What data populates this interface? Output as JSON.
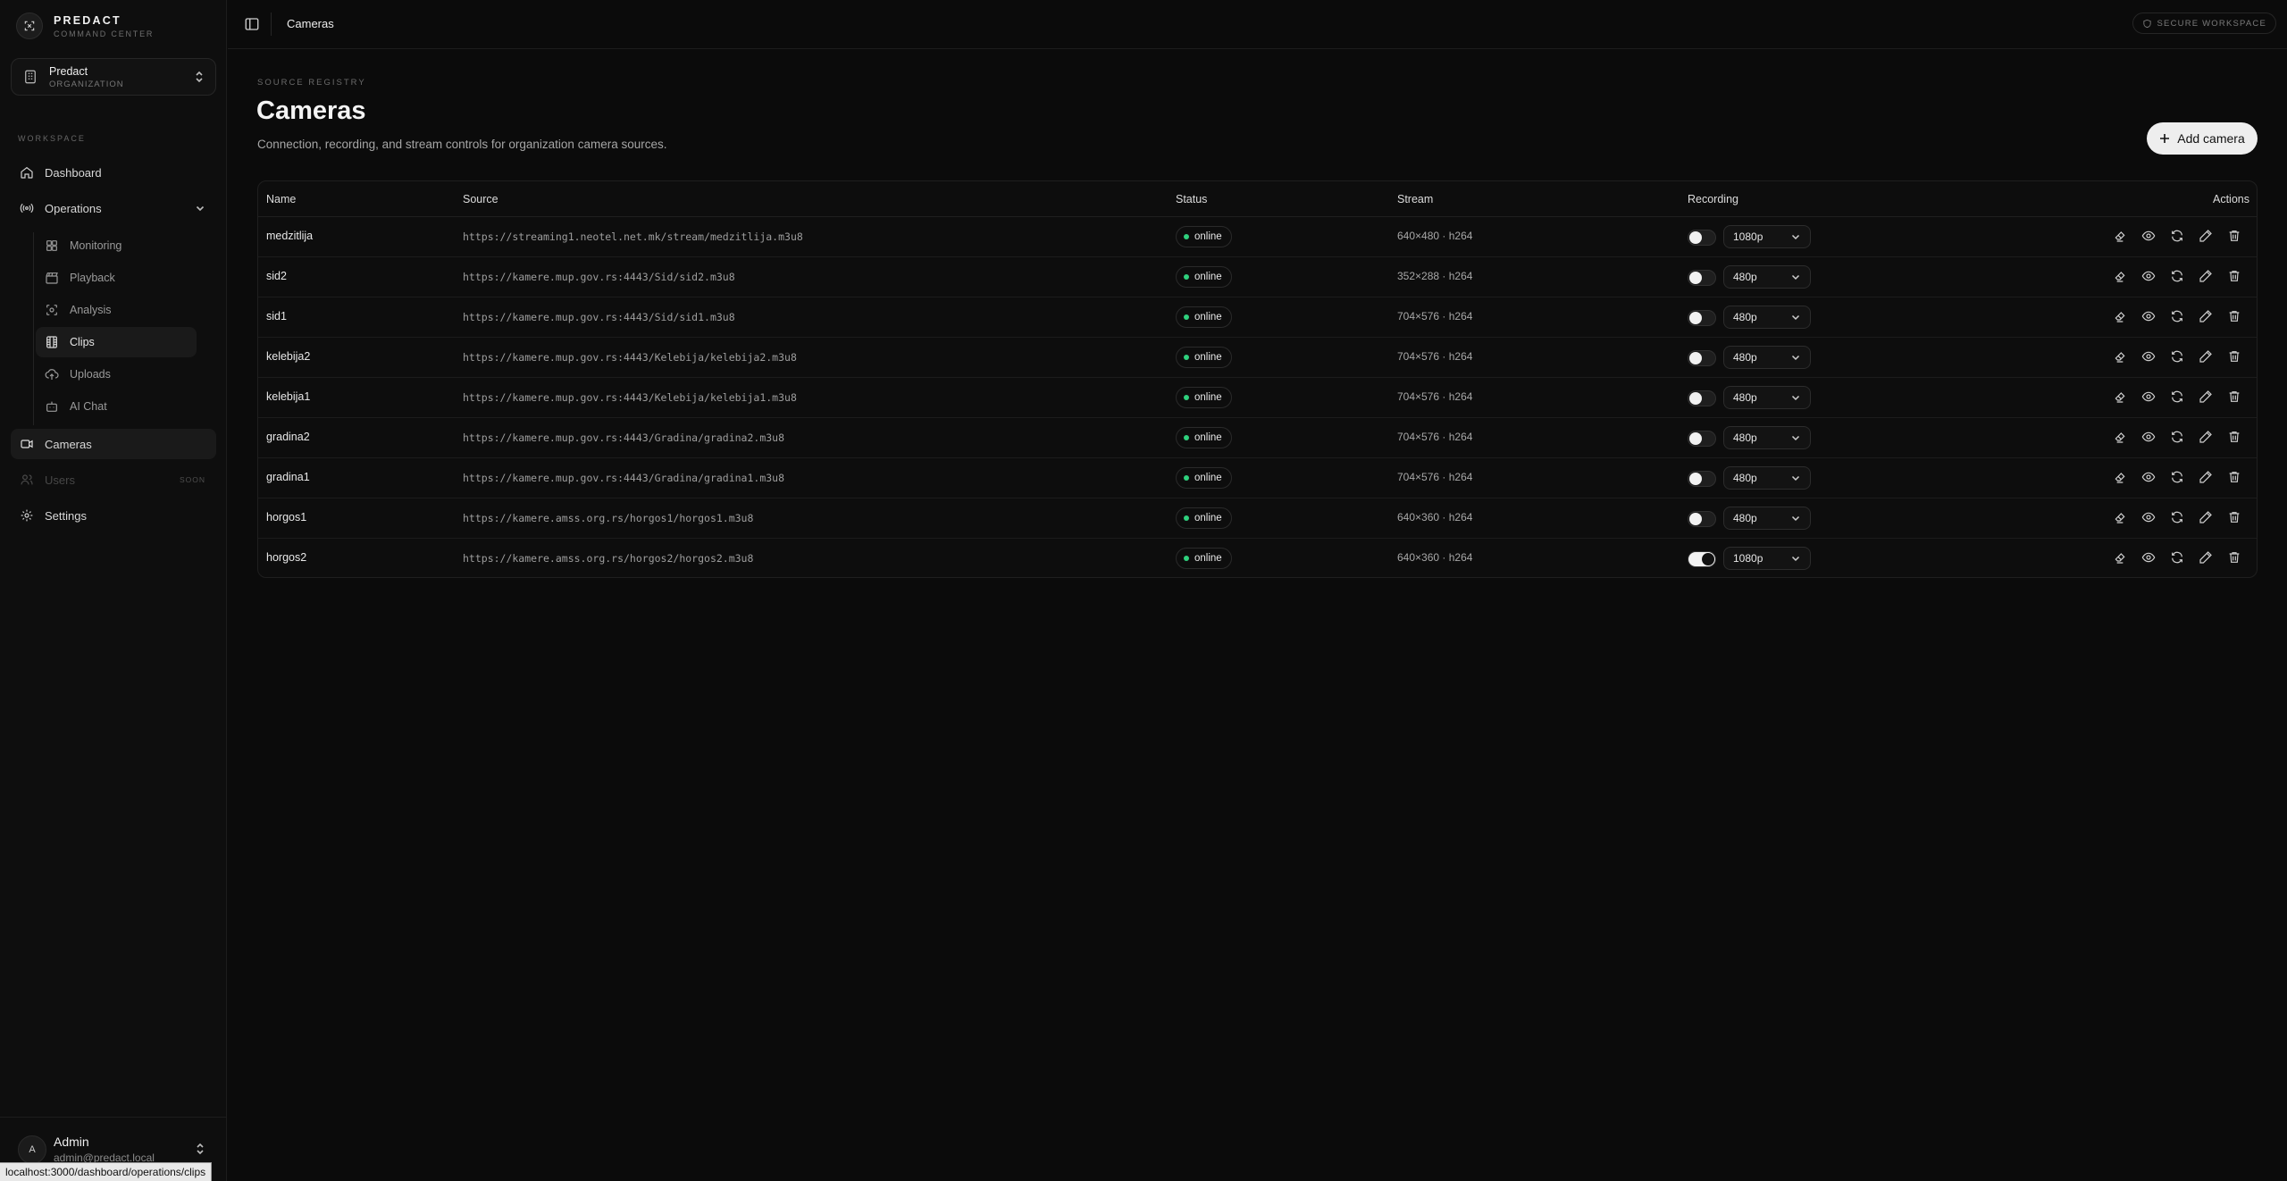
{
  "brand": {
    "name": "PREDACT",
    "subtitle": "COMMAND CENTER"
  },
  "org": {
    "name": "Predact",
    "type": "ORGANIZATION"
  },
  "sidebar": {
    "section_label": "WORKSPACE",
    "items": [
      {
        "label": "Dashboard",
        "icon": "home-icon"
      },
      {
        "label": "Operations",
        "icon": "radio-icon"
      },
      {
        "label": "Monitoring",
        "icon": "grid-icon"
      },
      {
        "label": "Playback",
        "icon": "clapperboard-icon"
      },
      {
        "label": "Analysis",
        "icon": "scan-icon"
      },
      {
        "label": "Clips",
        "icon": "film-icon"
      },
      {
        "label": "Uploads",
        "icon": "cloud-upload-icon"
      },
      {
        "label": "AI Chat",
        "icon": "bot-icon"
      },
      {
        "label": "Cameras",
        "icon": "video-icon"
      },
      {
        "label": "Users",
        "icon": "users-icon",
        "badge": "SOON"
      },
      {
        "label": "Settings",
        "icon": "gear-icon"
      }
    ]
  },
  "user": {
    "initial": "A",
    "name": "Admin",
    "email": "admin@predact.local"
  },
  "topbar": {
    "breadcrumb": "Cameras",
    "badge": "SECURE WORKSPACE"
  },
  "header": {
    "eyebrow": "SOURCE REGISTRY",
    "title": "Cameras",
    "description": "Connection, recording, and stream controls for organization camera sources.",
    "add_button": "Add camera"
  },
  "table": {
    "columns": [
      "Name",
      "Source",
      "Status",
      "Stream",
      "Recording",
      "Actions"
    ],
    "rows": [
      {
        "name": "medzitlija",
        "source": "https://streaming1.neotel.net.mk/stream/medzitlija.m3u8",
        "status": "online",
        "stream": "640×480 · h264",
        "recording": false,
        "resolution": "1080p"
      },
      {
        "name": "sid2",
        "source": "https://kamere.mup.gov.rs:4443/Sid/sid2.m3u8",
        "status": "online",
        "stream": "352×288 · h264",
        "recording": false,
        "resolution": "480p"
      },
      {
        "name": "sid1",
        "source": "https://kamere.mup.gov.rs:4443/Sid/sid1.m3u8",
        "status": "online",
        "stream": "704×576 · h264",
        "recording": false,
        "resolution": "480p"
      },
      {
        "name": "kelebija2",
        "source": "https://kamere.mup.gov.rs:4443/Kelebija/kelebija2.m3u8",
        "status": "online",
        "stream": "704×576 · h264",
        "recording": false,
        "resolution": "480p"
      },
      {
        "name": "kelebija1",
        "source": "https://kamere.mup.gov.rs:4443/Kelebija/kelebija1.m3u8",
        "status": "online",
        "stream": "704×576 · h264",
        "recording": false,
        "resolution": "480p"
      },
      {
        "name": "gradina2",
        "source": "https://kamere.mup.gov.rs:4443/Gradina/gradina2.m3u8",
        "status": "online",
        "stream": "704×576 · h264",
        "recording": false,
        "resolution": "480p"
      },
      {
        "name": "gradina1",
        "source": "https://kamere.mup.gov.rs:4443/Gradina/gradina1.m3u8",
        "status": "online",
        "stream": "704×576 · h264",
        "recording": false,
        "resolution": "480p"
      },
      {
        "name": "horgos1",
        "source": "https://kamere.amss.org.rs/horgos1/horgos1.m3u8",
        "status": "online",
        "stream": "640×360 · h264",
        "recording": false,
        "resolution": "480p"
      },
      {
        "name": "horgos2",
        "source": "https://kamere.amss.org.rs/horgos2/horgos2.m3u8",
        "status": "online",
        "stream": "640×360 · h264",
        "recording": true,
        "resolution": "1080p"
      }
    ],
    "row_actions": [
      "eraser-icon",
      "eye-icon",
      "refresh-icon",
      "pencil-icon",
      "trash-icon"
    ]
  },
  "statusbar": {
    "url": "localhost:3000/dashboard/operations/clips"
  },
  "colors": {
    "background": "#0b0b0b",
    "status_online": "#2fd07d",
    "accent_button": "#eeeeee"
  }
}
